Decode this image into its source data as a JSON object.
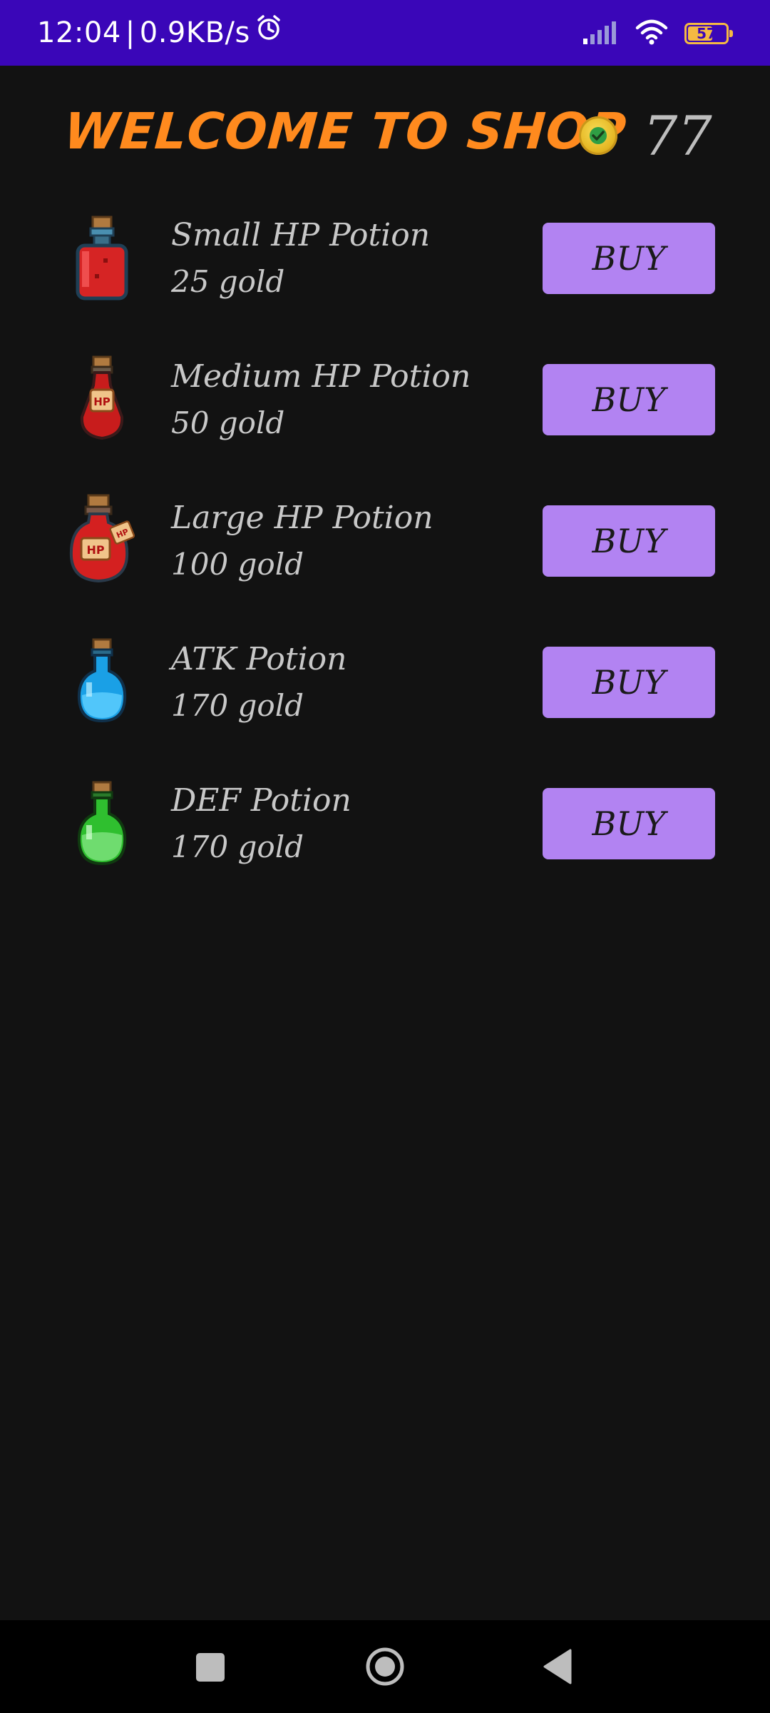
{
  "status_bar": {
    "time": "12:04",
    "separator": "|",
    "network_speed": "0.9KB/s",
    "battery_level": "57",
    "icons": [
      "alarm-icon",
      "signal-icon",
      "wifi-icon",
      "battery-icon"
    ]
  },
  "header": {
    "title": "WELCOME TO SHOP",
    "gold_amount": "77",
    "coin_icon": "gold-coin-icon"
  },
  "items": [
    {
      "name": "Small HP Potion",
      "price": "25 gold",
      "button": "BUY",
      "icon": "small-hp-potion-icon"
    },
    {
      "name": "Medium HP Potion",
      "price": "50 gold",
      "button": "BUY",
      "icon": "medium-hp-potion-icon"
    },
    {
      "name": "Large HP Potion",
      "price": "100 gold",
      "button": "BUY",
      "icon": "large-hp-potion-icon"
    },
    {
      "name": "ATK Potion",
      "price": "170 gold",
      "button": "BUY",
      "icon": "atk-potion-icon"
    },
    {
      "name": "DEF Potion",
      "price": "170 gold",
      "button": "BUY",
      "icon": "def-potion-icon"
    }
  ],
  "potion_icon_labels": {
    "medium": "HP",
    "large": "HP",
    "large_tag": "HP"
  },
  "colors": {
    "status_bar": "#3a06b8",
    "background": "#121212",
    "title": "#ff8a1e",
    "buy_button": "#b283f2",
    "text": "#c8c8c8"
  },
  "nav_bar": {
    "icons": [
      "recents-square-icon",
      "home-circle-icon",
      "back-triangle-icon"
    ]
  }
}
